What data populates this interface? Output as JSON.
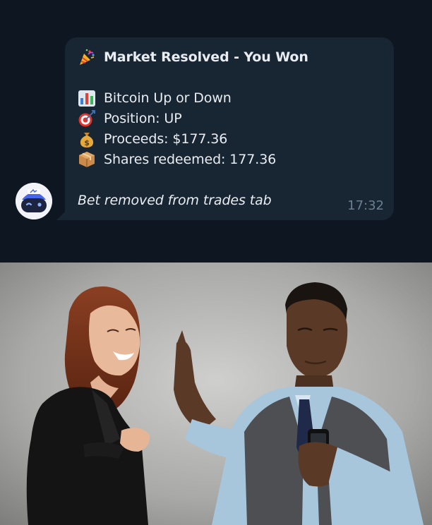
{
  "message": {
    "title": "Market Resolved - You Won",
    "market": "Bitcoin Up or Down",
    "position": "Position: UP",
    "proceeds": "Proceeds: $177.36",
    "shares": "Shares redeemed: 177.36",
    "note": "Bet removed from trades tab",
    "time": "17:32",
    "icons": [
      "party-popper-icon",
      "bar-chart-icon",
      "direct-hit-icon",
      "money-bag-icon",
      "package-icon"
    ]
  },
  "colors": {
    "chat_background": "#0e1621",
    "bubble": "#182533",
    "text": "#e9edf2",
    "time": "#6d7f8f"
  }
}
